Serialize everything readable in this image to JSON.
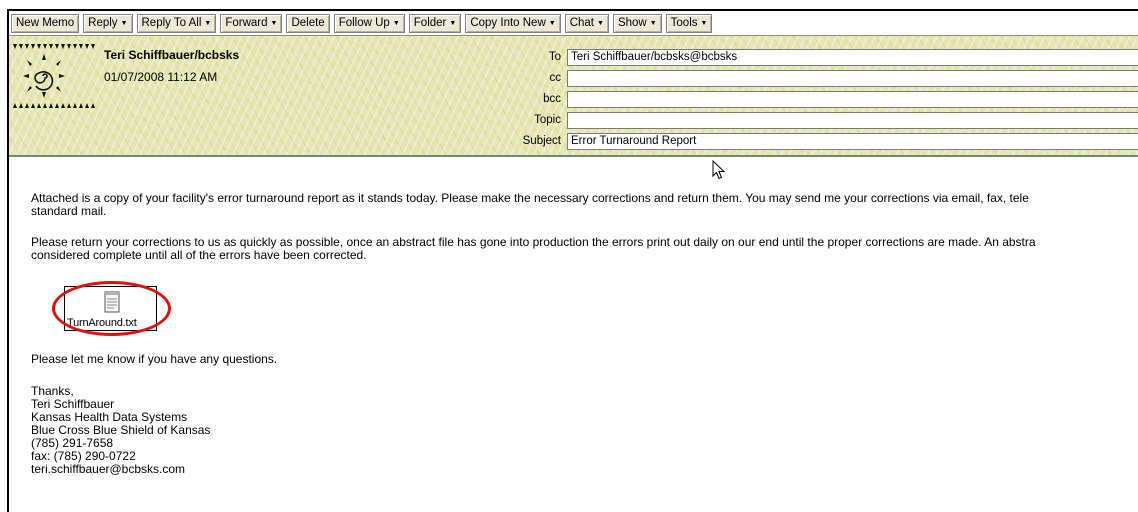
{
  "toolbar": {
    "buttons": [
      {
        "label": "New Memo",
        "dropdown": false
      },
      {
        "label": "Reply",
        "dropdown": true
      },
      {
        "label": "Reply To All",
        "dropdown": true
      },
      {
        "label": "Forward",
        "dropdown": true
      },
      {
        "label": "Delete",
        "dropdown": false
      },
      {
        "label": "Follow Up",
        "dropdown": true
      },
      {
        "label": "Folder",
        "dropdown": true
      },
      {
        "label": "Copy Into New",
        "dropdown": true
      },
      {
        "label": "Chat",
        "dropdown": true
      },
      {
        "label": "Show",
        "dropdown": true
      },
      {
        "label": "Tools",
        "dropdown": true
      }
    ]
  },
  "header": {
    "sender": "Teri Schiffbauer/bcbsks",
    "date": "01/07/2008 11:12 AM",
    "fields": [
      {
        "label": "To",
        "value": "Teri Schiffbauer/bcbsks@bcbsks"
      },
      {
        "label": "cc",
        "value": ""
      },
      {
        "label": "bcc",
        "value": ""
      },
      {
        "label": "Topic",
        "value": ""
      },
      {
        "label": "Subject",
        "value": "Error Turnaround Report"
      }
    ]
  },
  "body": {
    "paragraph1": [
      "Attached is a copy of your facility's error turnaround report as it stands today.  Please make the necessary corrections and return them.  You may send me your corrections via email, fax, tele",
      "standard mail."
    ],
    "paragraph2": [
      "Please return your corrections to us as quickly as possible, once an abstract file has gone into production the errors print out daily on our end until the proper corrections are made.  An abstra",
      "considered complete until all of the errors have been corrected."
    ],
    "attachment": {
      "filename": "TurnAround.txt",
      "icon": "text-file-icon",
      "highlight_color": "#e01010"
    },
    "closing_question": "Please let me know if you have any questions.",
    "signature": [
      "Thanks,",
      "Teri Schiffbauer",
      "Kansas Health Data Systems",
      "Blue Cross Blue Shield of Kansas",
      "(785) 291-7658",
      "fax: (785) 290-0722",
      "teri.schiffbauer@bcbsks.com"
    ]
  },
  "colors": {
    "header_background": "#e6e7b6",
    "button_face": "#ece9d8",
    "circle": "#e01010"
  }
}
